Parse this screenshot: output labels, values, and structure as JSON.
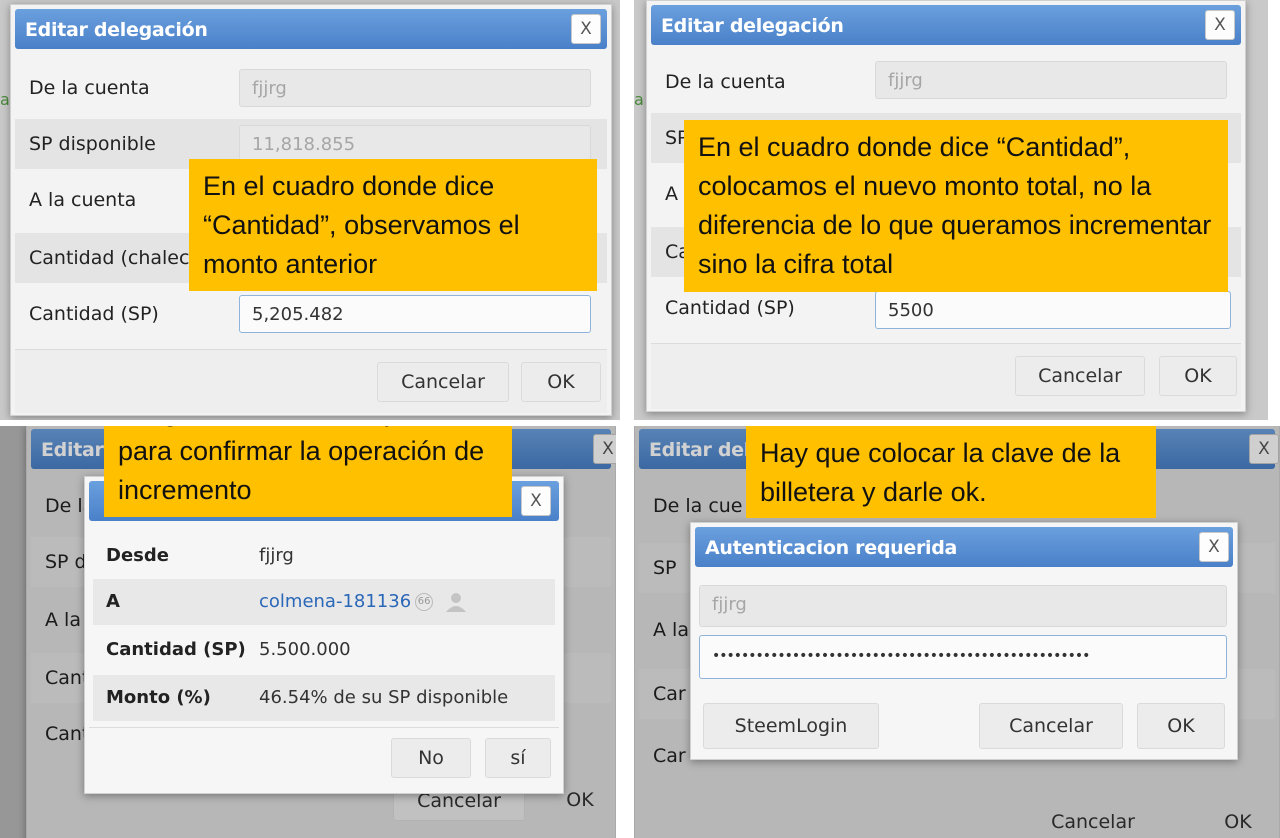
{
  "q1": {
    "title": "Editar delegación",
    "close": "X",
    "rows": [
      {
        "label": "De la cuenta",
        "value": "fjjrg"
      },
      {
        "label": "SP disponible",
        "value": "11,818.855"
      },
      {
        "label": "A la cuenta",
        "value": ""
      },
      {
        "label": "Cantidad (chaleco",
        "value": ""
      },
      {
        "label": "Cantidad (SP)",
        "value": "5,205.482"
      }
    ],
    "cancel": "Cancelar",
    "ok": "OK",
    "callout": "En el cuadro donde dice “Cantidad”, observamos el monto anterior"
  },
  "q2": {
    "title": "Editar delegación",
    "close": "X",
    "rows": [
      {
        "label": "De la cuenta",
        "value": "fjjrg"
      },
      {
        "label": "SP",
        "value": ""
      },
      {
        "label": "A",
        "value": ""
      },
      {
        "label": "Ca",
        "value": ""
      },
      {
        "label": "Cantidad (SP)",
        "value": "5500"
      }
    ],
    "cancel": "Cancelar",
    "ok": "OK",
    "callout": "En el cuadro donde dice “Cantidad”, colocamos el nuevo monto total, no la diferencia de lo que queramos incrementar sino la cifra total"
  },
  "q3": {
    "bg_title": "Editar d",
    "bg_close": "X",
    "bg_rows": [
      "De la",
      "SP di",
      "A la c",
      "Cant",
      "Cant"
    ],
    "bg_cancel": "Cancelar",
    "bg_ok": "OK",
    "confirm": {
      "close": "X",
      "rows": [
        {
          "label": "Desde",
          "value": "fjjrg"
        },
        {
          "label": "A",
          "value": "colmena-181136",
          "badge": "66"
        },
        {
          "label": "Cantidad (SP)",
          "value": "5.500.000"
        },
        {
          "label": "Monto (%)",
          "value": "46.54% de su SP disponible"
        }
      ],
      "no": "No",
      "yes": "sí"
    },
    "callout": "Luego sale una micro pantalla para confirmar la operación de incremento"
  },
  "q4": {
    "bg_title": "Editar del",
    "bg_close": "X",
    "bg_rows": [
      "De la cue",
      "SP",
      "A la",
      "Car",
      "Car"
    ],
    "bg_cancel": "Cancelar",
    "bg_ok": "OK",
    "auth": {
      "title": "Autenticacion requerida",
      "close": "X",
      "username": "fjjrg",
      "password": "••••••••••••••••••••••••••••••••••••••••••••••••••••",
      "steemlogin": "SteemLogin",
      "cancel": "Cancelar",
      "ok": "OK"
    },
    "callout": "Hay que colocar la clave de la billetera y darle ok."
  },
  "colors": {
    "header": "#4a80c8",
    "callout": "#ffc000",
    "link": "#2a67b8"
  }
}
